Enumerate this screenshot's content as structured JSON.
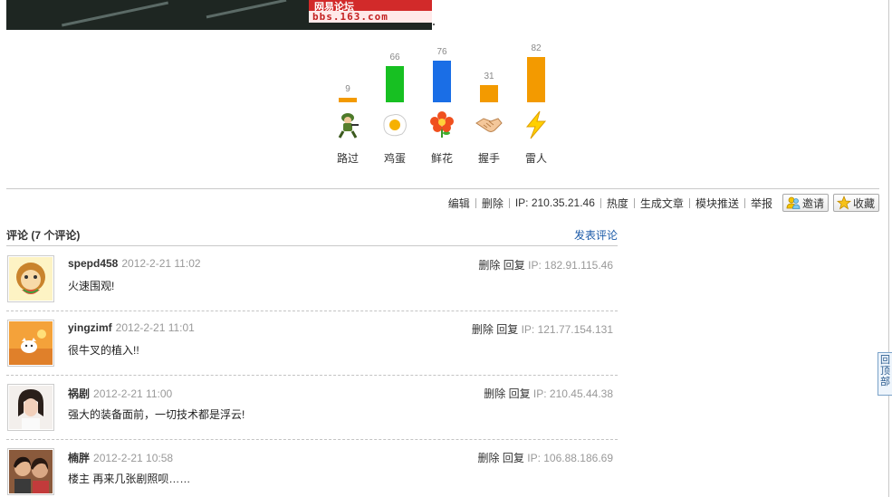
{
  "banner": {
    "watermark_text": "网易论坛",
    "watermark_url": "bbs.163.com"
  },
  "chart_data": {
    "type": "bar",
    "categories": [
      "路过",
      "鸡蛋",
      "鲜花",
      "握手",
      "雷人"
    ],
    "values": [
      9,
      66,
      76,
      31,
      82
    ],
    "colors": [
      "#f39a00",
      "#17c022",
      "#1a6ee6",
      "#f39a00",
      "#f39a00"
    ],
    "icons": [
      "soldier-icon",
      "egg-icon",
      "flower-icon",
      "handshake-icon",
      "lightning-icon"
    ]
  },
  "toolbar": {
    "items": [
      "编辑",
      "删除",
      "IP: 210.35.21.46",
      "热度",
      "生成文章",
      "模块推送",
      "举报"
    ],
    "invite": "邀请",
    "favorite": "收藏"
  },
  "comments_section": {
    "title": "评论 (7 个评论)",
    "post_link": "发表评论"
  },
  "comments": [
    {
      "user": "spepd458",
      "date": "2012-2-21 11:02",
      "delete": "删除",
      "reply": "回复",
      "ip": "IP: 182.91.115.46",
      "text": "火速围观!"
    },
    {
      "user": "yingzimf",
      "date": "2012-2-21 11:01",
      "delete": "删除",
      "reply": "回复",
      "ip": "IP: 121.77.154.131",
      "text": "很牛叉的植入!!"
    },
    {
      "user": "祸剧",
      "date": "2012-2-21 11:00",
      "delete": "删除",
      "reply": "回复",
      "ip": "IP: 210.45.44.38",
      "text": "强大的装备面前，一切技术都是浮云!"
    },
    {
      "user": "楠胖",
      "date": "2012-2-21 10:58",
      "delete": "删除",
      "reply": "回复",
      "ip": "IP: 106.88.186.69",
      "text": "楼主 再来几张剧照呗……"
    }
  ],
  "back_to_top": [
    "回",
    "顶",
    "部"
  ]
}
